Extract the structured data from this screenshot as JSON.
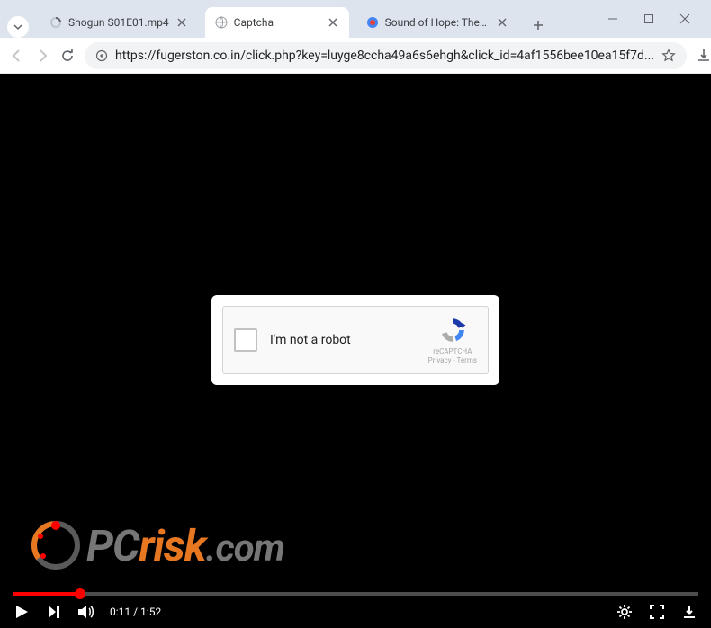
{
  "window": {
    "tabs": [
      {
        "title": "Shogun S01E01.mp4",
        "favicon": "loading"
      },
      {
        "title": "Captcha",
        "favicon": "globe",
        "active": true
      },
      {
        "title": "Sound of Hope: The Story o",
        "favicon": "colored"
      }
    ]
  },
  "toolbar": {
    "url": "https://fugerston.co.in/click.php?key=luyge8ccha49a6s6ehgh&click_id=4af1556bee10ea15f7d..."
  },
  "captcha": {
    "label": "I'm not a robot",
    "brand": "reCAPTCHA",
    "legal": "Privacy - Terms"
  },
  "watermark": {
    "pc": "PC",
    "risk": "risk",
    "com": ".com"
  },
  "player": {
    "elapsed": "0:11",
    "duration": "1:52",
    "separator": " / ",
    "progress_pct": 9.8
  }
}
